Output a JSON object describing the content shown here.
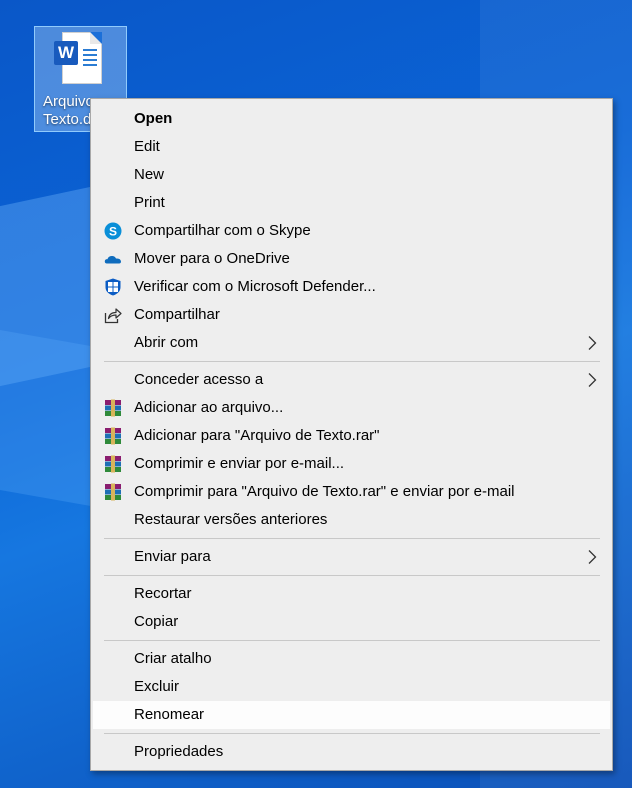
{
  "file": {
    "label_line1": "Arquivo",
    "label_line2": "Texto.d",
    "badge": "W"
  },
  "menu": {
    "items": [
      {
        "label": "Open"
      },
      {
        "label": "Edit"
      },
      {
        "label": "New"
      },
      {
        "label": "Print"
      },
      {
        "label": "Compartilhar com o Skype",
        "icon": "skype-icon"
      },
      {
        "label": "Mover para o OneDrive",
        "icon": "onedrive-icon"
      },
      {
        "label": "Verificar com o Microsoft Defender...",
        "icon": "defender-icon"
      },
      {
        "label": "Compartilhar",
        "icon": "share-icon"
      },
      {
        "label": "Abrir com",
        "icon": "chevron-right-icon"
      },
      {
        "label": "Conceder acesso a",
        "icon": "chevron-right-icon"
      },
      {
        "label": "Adicionar ao arquivo...",
        "icon": "winrar-icon"
      },
      {
        "label": "Adicionar para \"Arquivo de Texto.rar\"",
        "icon": "winrar-icon"
      },
      {
        "label": "Comprimir e enviar por e-mail...",
        "icon": "winrar-icon"
      },
      {
        "label": "Comprimir para \"Arquivo de Texto.rar\" e enviar por e-mail",
        "icon": "winrar-icon"
      },
      {
        "label": "Restaurar versões anteriores"
      },
      {
        "label": "Enviar para",
        "icon": "chevron-right-icon"
      },
      {
        "label": "Recortar"
      },
      {
        "label": "Copiar"
      },
      {
        "label": "Criar atalho"
      },
      {
        "label": "Excluir"
      },
      {
        "label": "Renomear",
        "state": "highlighted"
      },
      {
        "label": "Propriedades"
      }
    ]
  },
  "colors": {
    "desktop": "#0b64d6",
    "menu_bg": "#eeeeee",
    "highlight": "#fdfdfd"
  }
}
